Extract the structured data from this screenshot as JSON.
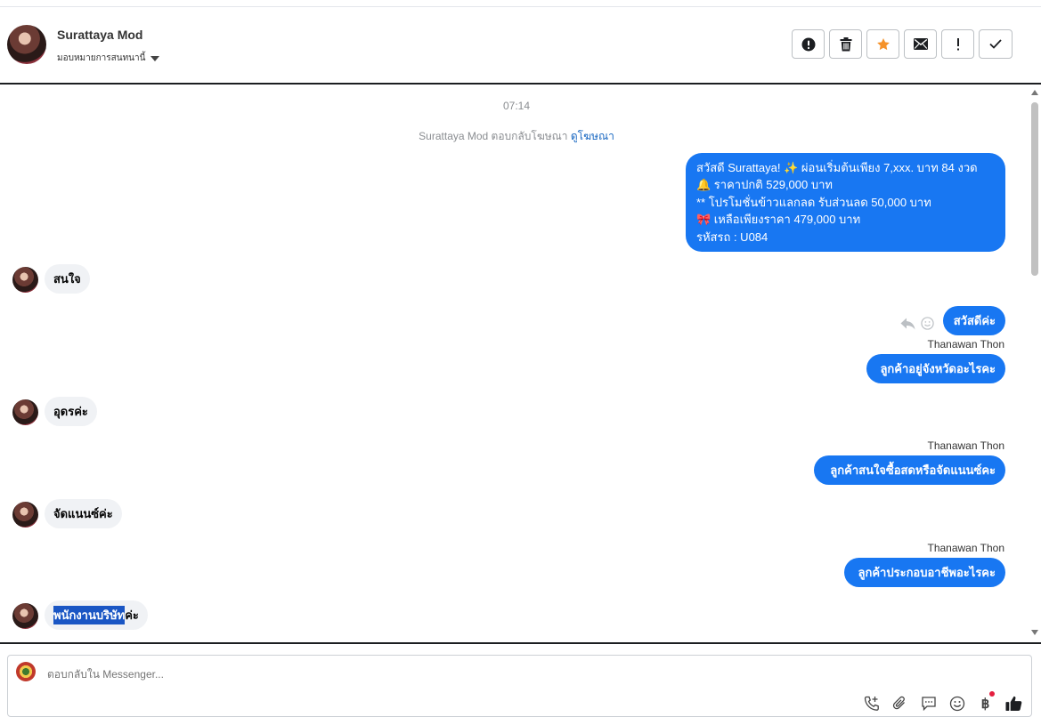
{
  "header": {
    "contact_name": "Surattaya Mod",
    "assign_label": "มอบหมายการสนทนานี้",
    "actions": [
      "mark-spam",
      "delete",
      "star",
      "mark-unread",
      "follow-up",
      "done"
    ]
  },
  "thread": {
    "timestamp": "07:14",
    "ad_reply_text": "Surattaya Mod ตอบกลับโฆษณา",
    "ad_link": "ดูโฆษณา",
    "promo_lines": [
      "สวัสดี Surattaya! ✨  ผ่อนเริ่มต้นเพียง 7,xxx. บาท 84 งวด",
      "🔔 ราคาปกติ 529,000 บาท",
      "** โปรโมชั่นข้าวแลกลด รับส่วนลด 50,000 บาท",
      "🎀  เหลือเพียงราคา 479,000 บาท",
      " รหัสรถ : U084"
    ],
    "msg_in_1": "สนใจ",
    "msg_out_1": "สวัสดีค่ะ",
    "sender_1": "Thanawan Thon",
    "msg_out_2": "ลูกค้าอยู่จังหวัดอะไรคะ",
    "msg_in_2": "อุดรค่ะ",
    "sender_2": "Thanawan Thon",
    "msg_out_3": "ลูกค้าสนใจซื้อสดหรือจัดแนนซ์คะ",
    "msg_in_3": "จัดแนนซ์ค่ะ",
    "sender_3": "Thanawan Thon",
    "msg_out_4": "ลูกค้าประกอบอาชีพอะไรคะ",
    "msg_in_4_highlight": "พนักงานบริษัท",
    "msg_in_4_rest": "ค่ะ"
  },
  "composer": {
    "placeholder": "ตอบกลับใน Messenger...",
    "tools": [
      "call-add-icon",
      "attachment-icon",
      "saved-reply-icon",
      "emoji-icon",
      "baht-payment-icon",
      "like-icon"
    ],
    "baht_symbol": "฿"
  },
  "colors": {
    "outgoing_bubble": "#1877f2",
    "incoming_bubble": "#f0f2f5",
    "star": "#f5922a",
    "highlight": "#1a56c4"
  }
}
